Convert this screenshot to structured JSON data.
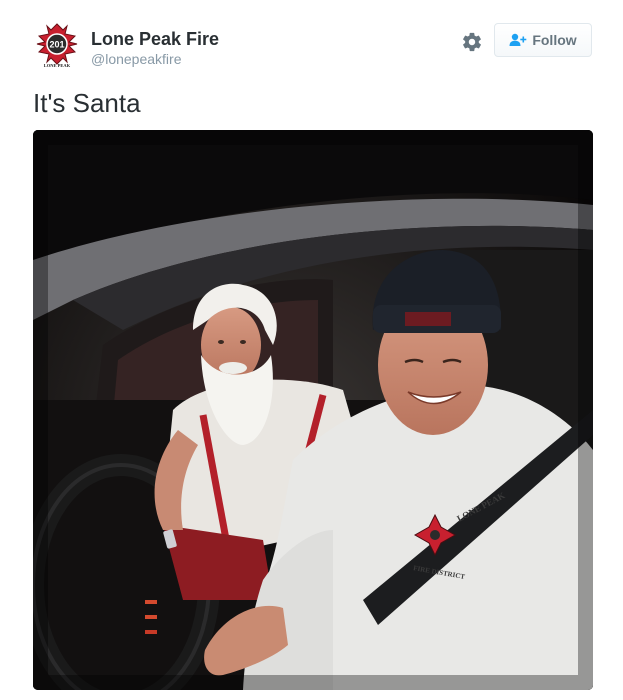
{
  "tweet": {
    "author": {
      "display_name": "Lone Peak Fire",
      "handle": "@lonepeakfire",
      "avatar": {
        "badge_number": "201",
        "caption": "LONE PEAK",
        "icon": "maltese-cross-logo"
      }
    },
    "actions": {
      "settings_icon": "gear-icon",
      "follow_icon": "add-user-icon",
      "follow_label": "Follow"
    },
    "text": "It's Santa",
    "photo": {
      "icon": "photo",
      "shirt_print": {
        "line1": "LONE PEAK",
        "line2": "FIRE DISTRICT"
      },
      "colors": {
        "background": "#0d0a0a",
        "shirt": "#e8e8e6",
        "beanie": "#1b1f27"
      }
    }
  },
  "colors": {
    "text_primary": "#292f33",
    "text_secondary": "#8899a6",
    "button_text": "#66757f",
    "button_border": "#e1e8ed",
    "accent": "#1da1f2"
  }
}
